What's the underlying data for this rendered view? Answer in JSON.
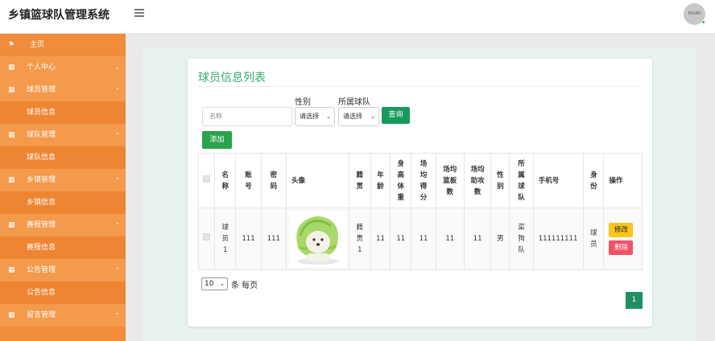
{
  "header": {
    "title": "乡镇篮球队管理系统",
    "avatar_text": "80x80"
  },
  "sidebar": {
    "home": "主页",
    "items": [
      {
        "label": "个人中心",
        "chevron": "⌄",
        "type": "group"
      },
      {
        "label": "球员管理",
        "chevron": "⌃",
        "type": "group"
      },
      {
        "label": "球员信息",
        "type": "sub"
      },
      {
        "label": "球队管理",
        "chevron": "⌃",
        "type": "group"
      },
      {
        "label": "球队信息",
        "type": "sub"
      },
      {
        "label": "乡镇管理",
        "chevron": "⌃",
        "type": "group"
      },
      {
        "label": "乡镇信息",
        "type": "sub"
      },
      {
        "label": "赛程管理",
        "chevron": "⌃",
        "type": "group"
      },
      {
        "label": "赛程信息",
        "type": "sub"
      },
      {
        "label": "公告管理",
        "chevron": "⌃",
        "type": "group"
      },
      {
        "label": "公告信息",
        "type": "sub"
      },
      {
        "label": "留言管理",
        "chevron": "⌃",
        "type": "group"
      }
    ]
  },
  "card": {
    "title": "球员信息列表",
    "filters": {
      "name_placeholder": "名称",
      "gender_label": "性别",
      "gender_value": "请选择",
      "team_label": "所属球队",
      "team_value": "请选择",
      "search_label": "查询"
    },
    "add_label": "添加",
    "table": {
      "headers": [
        "名称",
        "账号",
        "密码",
        "头像",
        "籍贯",
        "年龄",
        "身高体重",
        "场均得分",
        "场均篮板数",
        "场均助攻数",
        "性别",
        "所属球队",
        "手机号",
        "身份",
        "操作"
      ],
      "rows": [
        {
          "name": "球员1",
          "account": "111",
          "password": "111",
          "hometown": "籍贯1",
          "age": "11",
          "height_weight": "11",
          "avg_points": "11",
          "avg_rebounds": "11",
          "avg_assists": "11",
          "gender": "男",
          "team": "菜狗队",
          "phone": "111111111",
          "role": "球员",
          "edit_label": "修改",
          "delete_label": "删除"
        }
      ]
    },
    "pager": {
      "page_size": "10",
      "size_suffix": "条 每页",
      "current_page": "1"
    }
  },
  "colors": {
    "sidebar": "#f08c3a",
    "accent": "#3aa874",
    "search_button": "#179a5e",
    "add_button": "#2aa34a",
    "edit_button": "#f7c51b",
    "delete_button": "#f25166"
  }
}
